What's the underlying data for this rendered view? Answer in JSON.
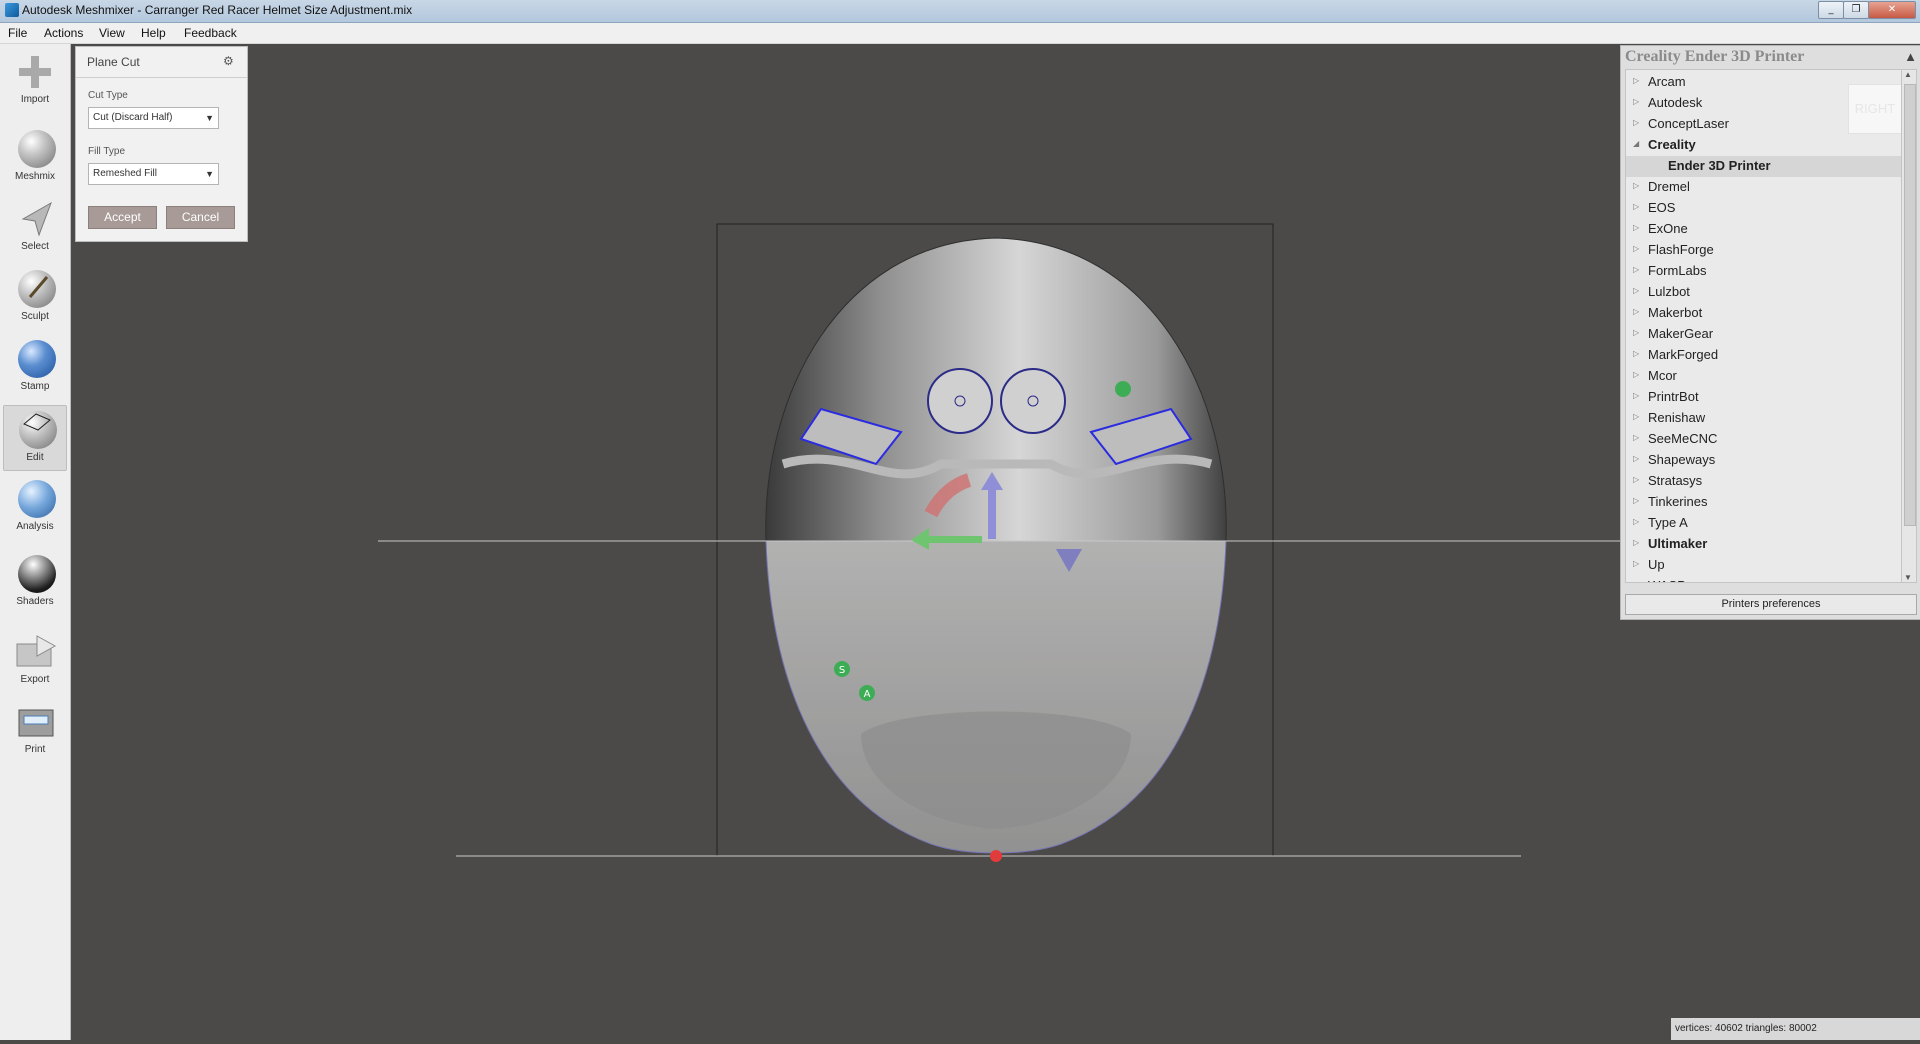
{
  "window": {
    "title": "Autodesk Meshmixer - Carranger Red Racer Helmet Size Adjustment.mix",
    "controls": [
      "_",
      "❐",
      "✕"
    ]
  },
  "menu": [
    "File",
    "Actions",
    "View",
    "Help",
    "Feedback"
  ],
  "toolbar": [
    {
      "label": "Import",
      "icon": "plus-icon"
    },
    {
      "label": "Meshmix",
      "icon": "meshmix-icon"
    },
    {
      "label": "Select",
      "icon": "arrow-cursor-icon"
    },
    {
      "label": "Sculpt",
      "icon": "brush-icon"
    },
    {
      "label": "Stamp",
      "icon": "stamp-icon"
    },
    {
      "label": "Edit",
      "icon": "edit-icon",
      "active": true
    },
    {
      "label": "Analysis",
      "icon": "analysis-icon"
    },
    {
      "label": "Shaders",
      "icon": "shader-sphere-icon"
    },
    {
      "label": "Export",
      "icon": "export-icon"
    },
    {
      "label": "Print",
      "icon": "printer-icon"
    }
  ],
  "plane_cut": {
    "title": "Plane Cut",
    "cut_type_label": "Cut Type",
    "cut_type_value": "Cut (Discard Half)",
    "fill_type_label": "Fill Type",
    "fill_type_value": "Remeshed Fill",
    "accept": "Accept",
    "cancel": "Cancel"
  },
  "printer": {
    "title": "Creality Ender 3D Printer",
    "view_label": "RIGHT",
    "items": [
      {
        "name": "Arcam"
      },
      {
        "name": "Autodesk"
      },
      {
        "name": "ConceptLaser"
      },
      {
        "name": "Creality",
        "expanded": true,
        "bold": true
      },
      {
        "name": "Ender 3D Printer",
        "child": true
      },
      {
        "name": "Dremel"
      },
      {
        "name": "EOS"
      },
      {
        "name": "ExOne"
      },
      {
        "name": "FlashForge"
      },
      {
        "name": "FormLabs"
      },
      {
        "name": "Lulzbot"
      },
      {
        "name": "Makerbot"
      },
      {
        "name": "MakerGear"
      },
      {
        "name": "MarkForged"
      },
      {
        "name": "Mcor"
      },
      {
        "name": "PrintrBot"
      },
      {
        "name": "Renishaw"
      },
      {
        "name": "SeeMeCNC"
      },
      {
        "name": "Shapeways"
      },
      {
        "name": "Stratasys"
      },
      {
        "name": "Tinkerines"
      },
      {
        "name": "Type A"
      },
      {
        "name": "Ultimaker",
        "bold": true
      },
      {
        "name": "Up"
      },
      {
        "name": "WASP"
      }
    ],
    "preferences_button": "Printers preferences"
  },
  "status": "vertices: 40602 triangles: 80002",
  "gizmo_labels": {
    "s": "S",
    "a": "A"
  }
}
